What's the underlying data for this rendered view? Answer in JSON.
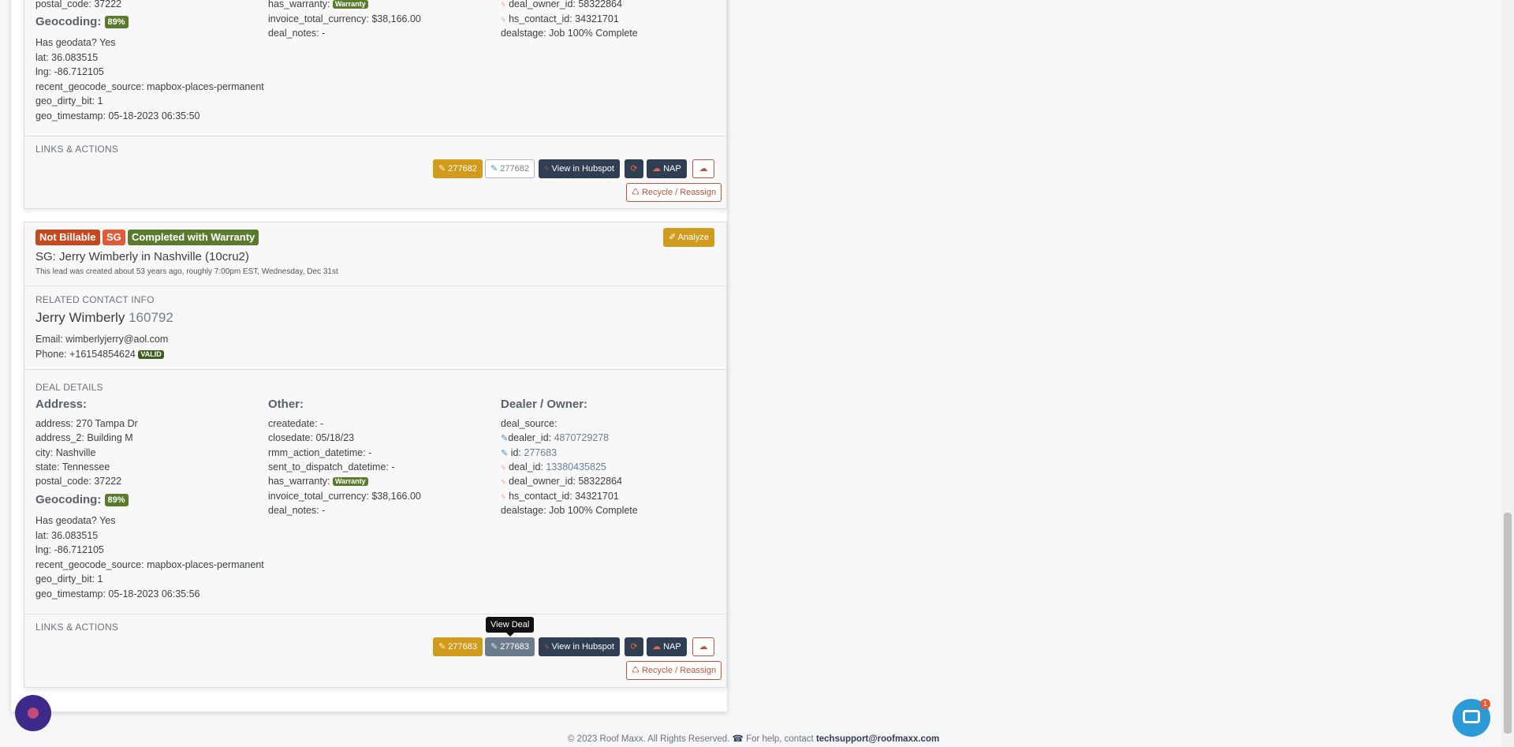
{
  "top": {
    "lines_left": [
      "postal_code: 37222"
    ],
    "geocoding_label": "Geocoding:",
    "geocoding_pct": "89%",
    "geo_lines": [
      "Has geodata? Yes",
      "lat: 36.083515",
      "lng: -86.712105",
      "recent_geocode_source: mapbox-places-permanent",
      "geo_dirty_bit: 1",
      "geo_timestamp: 05-18-2023 06:35:50"
    ],
    "has_warranty": "has_warranty:",
    "warranty_badge": "Warranty",
    "invoice": "invoice_total_currency: $38,166.00",
    "deal_notes": "deal_notes: -",
    "deal_owner": "deal_owner_id: 58322864",
    "hs_contact": "hs_contact_id: 34321701",
    "dealstage": "dealstage: Job 100% Complete",
    "links_title": "LINKS & ACTIONS",
    "btn_id_gold": "277682",
    "btn_id_out": "277682",
    "btn_hubspot": "View in Hubspot",
    "btn_nap": "NAP",
    "btn_recycle": "Recycle / Reassign"
  },
  "card": {
    "tag_not_billable": "Not Billable",
    "tag_sg": "SG",
    "tag_status": "Completed with Warranty",
    "btn_analyze": "Analyze",
    "title": "SG: Jerry Wimberly in Nashville (10cru2)",
    "created": "This lead was created about 53 years ago, roughly 7:00pm EST, Wednesday, Dec 31st",
    "contact_section": "RELATED CONTACT INFO",
    "contact_name": "Jerry Wimberly",
    "contact_id": "160792",
    "email": "Email: wimberlyjerry@aol.com",
    "phone": "Phone: +16154854624",
    "phone_valid": "VALID",
    "deal_section": "DEAL DETAILS",
    "address_hdr": "Address:",
    "address_lines": [
      "address: 270 Tampa Dr",
      "address_2: Building M",
      "city: Nashville",
      "state: Tennessee",
      "postal_code: 37222"
    ],
    "geocoding_label": "Geocoding:",
    "geocoding_pct": "89%",
    "geo_lines": [
      "Has geodata? Yes",
      "lat: 36.083515",
      "lng: -86.712105",
      "recent_geocode_source: mapbox-places-permanent",
      "geo_dirty_bit: 1",
      "geo_timestamp: 05-18-2023 06:35:56"
    ],
    "other_hdr": "Other:",
    "other_lines": [
      "createdate: -",
      "closedate: 05/18/23",
      "rmm_action_datetime: -",
      "sent_to_dispatch_datetime: -"
    ],
    "has_warranty": "has_warranty:",
    "warranty_badge": "Warranty",
    "invoice": "invoice_total_currency: $38,166.00",
    "deal_notes": "deal_notes: -",
    "dealer_hdr": "Dealer / Owner:",
    "deal_source": "deal_source:",
    "dealer_id_label": "dealer_id:",
    "dealer_id": "4870729278",
    "id_label": "id:",
    "id_val": "277683",
    "deal_id_label": "deal_id:",
    "deal_id": "13380435825",
    "deal_owner": "deal_owner_id: 58322864",
    "hs_contact": "hs_contact_id: 34321701",
    "dealstage": "dealstage: Job 100% Complete",
    "links_title": "LINKS & ACTIONS",
    "tooltip": "View Deal",
    "btn_id_gold": "277683",
    "btn_id_gray": "277683",
    "btn_hubspot": "View in Hubspot",
    "btn_nap": "NAP",
    "btn_recycle": "Recycle / Reassign"
  },
  "footer": {
    "copyright": "© 2023 Roof Maxx. All Rights Reserved.",
    "help": "For help, contact",
    "email": "techsupport@roofmaxx.com"
  },
  "chat": {
    "badge": "1"
  },
  "colors": {
    "gold": "#d19b1d",
    "navy": "#2f3e52",
    "green": "#5a7a2e",
    "red": "#c0533c",
    "orange": "#e25a3a"
  }
}
